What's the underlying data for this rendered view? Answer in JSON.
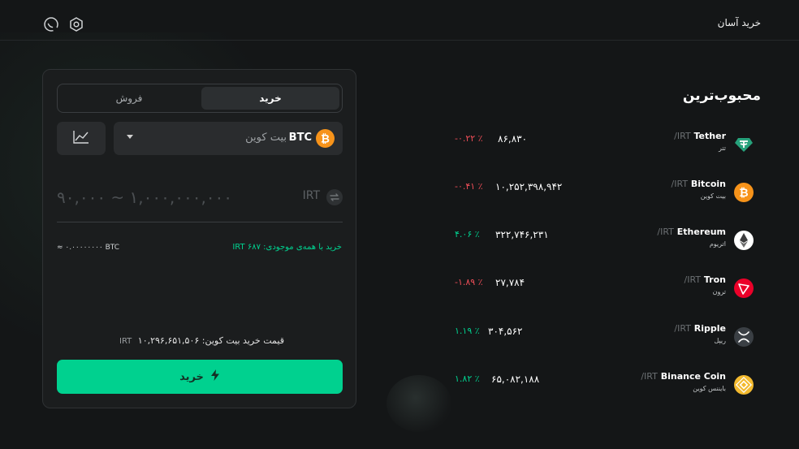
{
  "header": {
    "title": "خرید آسان",
    "icons": [
      "support-icon",
      "settings-icon"
    ]
  },
  "trade": {
    "tab_buy": "خرید",
    "tab_sell": "فروش",
    "selected_coin": {
      "symbol": "BTC",
      "name_fa": "بیت کوین"
    },
    "amount_placeholder": "۹۰,۰۰۰ ~ ۱,۰۰۰,۰۰۰,۰۰۰",
    "amount_currency": "IRT",
    "balance_text": "خرید با همه‌ی موجودی: ۶۸۷ IRT",
    "approx_text": "≈ ۰.۰۰۰۰۰۰۰۰ BTC",
    "price_label": "قیمت خرید بیت کوین:",
    "price_unit": "IRT",
    "price_value": "۱۰,۲۹۶,۶۵۱,۵۰۶",
    "buy_button": "خرید"
  },
  "popular": {
    "title": "محبوب‌ترین",
    "items": [
      {
        "name": "Tether",
        "unit": "/IRT",
        "name_fa": "تتر",
        "price": "۸۶,۸۳۰",
        "change": "-۰.۲۲ ٪",
        "direction": "down",
        "icon": "tether-icon",
        "color": "#26a17b"
      },
      {
        "name": "Bitcoin",
        "unit": "/IRT",
        "name_fa": "بیت کوین",
        "price": "۱۰,۲۵۲,۳۹۸,۹۴۲",
        "change": "-۰.۴۱ ٪",
        "direction": "down",
        "icon": "bitcoin-icon",
        "color": "#f7931a"
      },
      {
        "name": "Ethereum",
        "unit": "/IRT",
        "name_fa": "اتریوم",
        "price": "۳۲۲,۷۴۶,۲۳۱",
        "change": "۴.۰۶ ٪",
        "direction": "up",
        "icon": "ethereum-icon",
        "color": "#ffffff"
      },
      {
        "name": "Tron",
        "unit": "/IRT",
        "name_fa": "ترون",
        "price": "۲۷,۷۸۴",
        "change": "-۱.۸۹ ٪",
        "direction": "down",
        "icon": "tron-icon",
        "color": "#eb0029"
      },
      {
        "name": "Ripple",
        "unit": "/IRT",
        "name_fa": "ریپل",
        "price": "۳۰۴,۵۶۲",
        "change": "۱.۱۹ ٪",
        "direction": "up",
        "icon": "ripple-icon",
        "color": "#3a3f44"
      },
      {
        "name": "Binance Coin",
        "unit": "/IRT",
        "name_fa": "بایننس کوین",
        "price": "۶۵,۰۸۲,۱۸۸",
        "change": "۱.۸۲ ٪",
        "direction": "up",
        "icon": "bnb-icon",
        "color": "#f3ba2f"
      }
    ]
  },
  "colors": {
    "accent": "#00d18f",
    "negative": "#f04e58",
    "background": "#141617",
    "card": "#1b1d1e"
  }
}
